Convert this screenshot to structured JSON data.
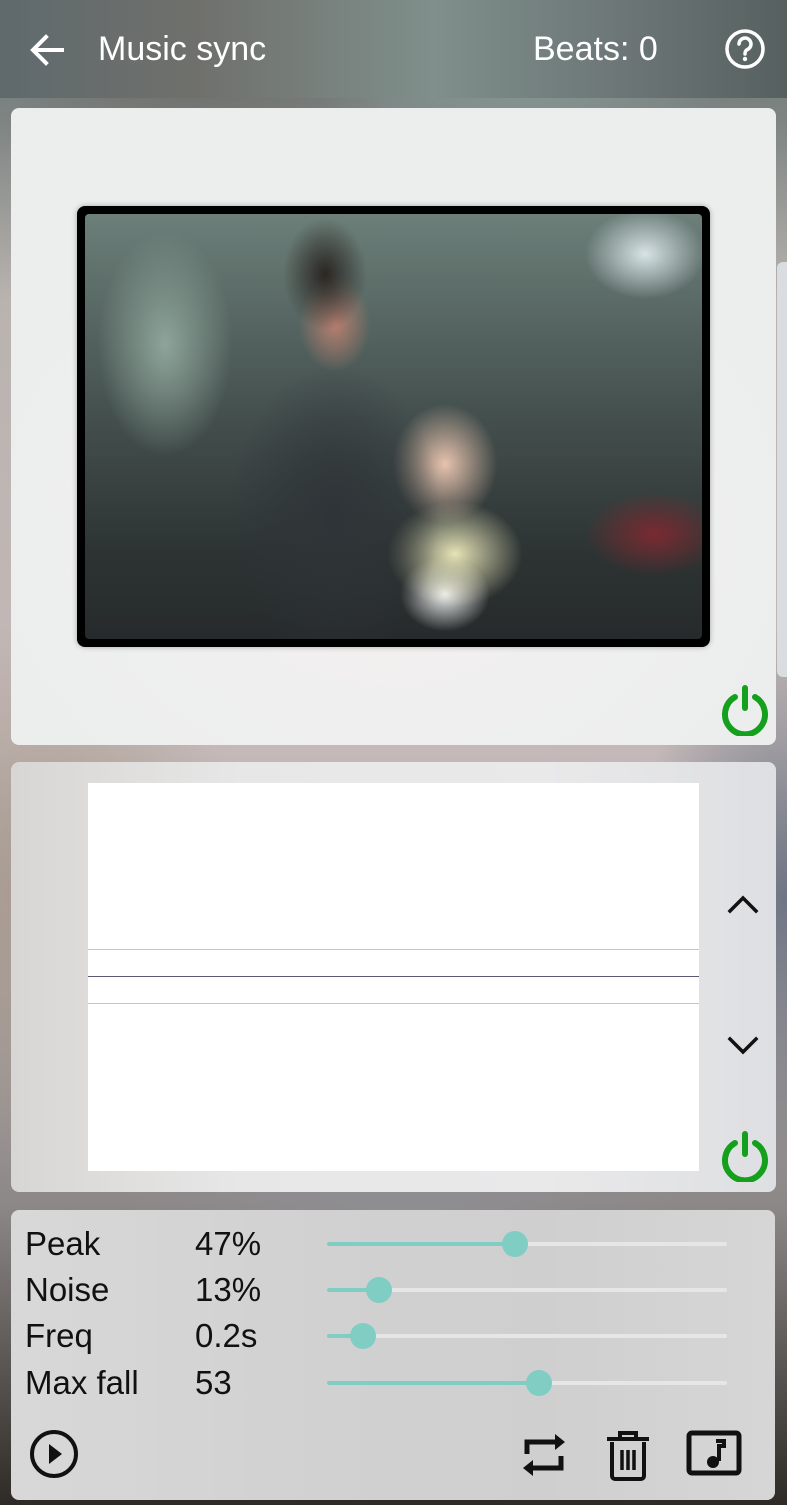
{
  "header": {
    "title": "Music sync",
    "beats_label": "Beats: 0",
    "back_icon": "arrow-left-icon",
    "help_icon": "help-circle-icon"
  },
  "photo_panel": {
    "image_alt": "Man in suit holding a baby in a yellow sweater",
    "power_icon": "power-icon",
    "power_color": "#14a01c"
  },
  "waveform_panel": {
    "scroll_up_icon": "chevron-up-icon",
    "scroll_down_icon": "chevron-down-icon",
    "power_icon": "power-icon",
    "power_color": "#14a01c"
  },
  "controls": {
    "params": [
      {
        "label": "Peak",
        "value": "47%",
        "slider_fraction": 0.47
      },
      {
        "label": "Noise",
        "value": "13%",
        "slider_fraction": 0.13
      },
      {
        "label": "Freq",
        "value": "0.2s",
        "slider_fraction": 0.09
      },
      {
        "label": "Max fall",
        "value": "53",
        "slider_fraction": 0.53
      }
    ],
    "accent_color": "#7fcdc3",
    "play_icon": "play-circle-icon",
    "repeat_icon": "repeat-icon",
    "delete_icon": "trash-icon",
    "music_icon": "music-note-icon"
  }
}
